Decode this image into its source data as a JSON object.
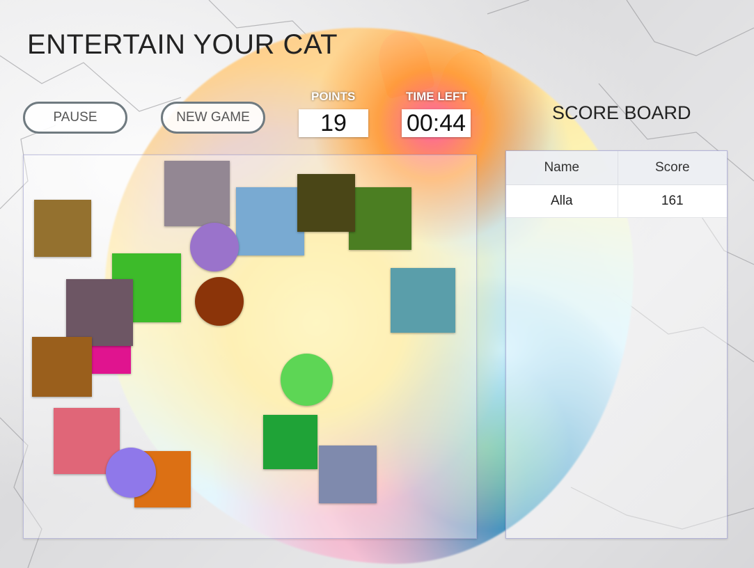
{
  "title": "ENTERTAIN YOUR CAT",
  "controls": {
    "pause_label": "PAUSE",
    "new_game_label": "NEW GAME"
  },
  "stats": {
    "points_label": "POINTS",
    "points_value": "19",
    "time_label": "TIME LEFT",
    "time_value": "00:44"
  },
  "score_board": {
    "title": "SCORE BOARD",
    "columns": [
      "Name",
      "Score"
    ],
    "rows": [
      {
        "name": "Alla",
        "score": "161"
      }
    ]
  },
  "shapes": [
    {
      "type": "square",
      "color": "#94712f"
    },
    {
      "type": "square",
      "color": "#938793"
    },
    {
      "type": "square",
      "color": "#79aad2"
    },
    {
      "type": "square",
      "color": "#4b7e22"
    },
    {
      "type": "square",
      "color": "#4a4617"
    },
    {
      "type": "circle",
      "color": "#9a73cb"
    },
    {
      "type": "square",
      "color": "#3dbb2a"
    },
    {
      "type": "square",
      "color": "#e0148f"
    },
    {
      "type": "square",
      "color": "#6d5664"
    },
    {
      "type": "circle",
      "color": "#8b3409"
    },
    {
      "type": "square",
      "color": "#5a9eaa"
    },
    {
      "type": "square",
      "color": "#9a5f1c"
    },
    {
      "type": "circle",
      "color": "#5dd655"
    },
    {
      "type": "square",
      "color": "#e06678"
    },
    {
      "type": "square",
      "color": "#dc7014"
    },
    {
      "type": "circle",
      "color": "#8f78ea"
    },
    {
      "type": "square",
      "color": "#1fa337"
    },
    {
      "type": "square",
      "color": "#7f8aad"
    }
  ]
}
